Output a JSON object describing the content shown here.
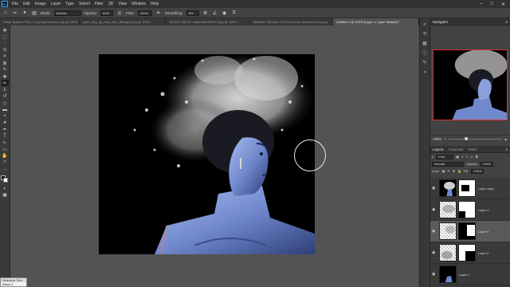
{
  "app": {
    "logo": "Ps"
  },
  "menu": [
    "File",
    "Edit",
    "Image",
    "Layer",
    "Type",
    "Select",
    "Filter",
    "3D",
    "View",
    "Window",
    "Help"
  ],
  "window_controls": [
    "–",
    "□",
    "✕"
  ],
  "options_bar": {
    "mode_label": "Mode:",
    "mode_value": "Normal",
    "opacity_label": "Opacity:",
    "opacity_value": "60%",
    "flow_label": "Flow:",
    "flow_value": "100%",
    "smoothing_label": "Smoothing:",
    "smoothing_value": "0%"
  },
  "doc_tabs": [
    {
      "label": "Water Splash PNGs 2 by pngchampion.png @ 100% ...",
      "active": false
    },
    {
      "label": "apex_png_by_mau_AVL_8Sbb(p).png @ 100% ...",
      "active": false
    },
    {
      "label": "1873d3~d06-071-6fa0-89bf3fd7c0.png @ 100% ...",
      "active": false
    },
    {
      "label": "8f2a5d0~4b0405c-4778-9ccf-83e-4b9cc2cc1fed.png",
      "active": false
    },
    {
      "label": "Untitled-1 @ 100% (Layer 1, Layer Mask/8) *",
      "active": true
    }
  ],
  "tools": [
    "move-tool",
    "marquee-tool",
    "lasso-tool",
    "quick-select-tool",
    "crop-tool",
    "frame-tool",
    "eyedropper-tool",
    "healing-tool",
    "brush-tool",
    "clone-stamp-tool",
    "history-brush-tool",
    "eraser-tool",
    "gradient-tool",
    "blur-tool",
    "dodge-tool",
    "pen-tool",
    "type-tool",
    "path-select-tool",
    "shape-tool",
    "hand-tool",
    "zoom-tool",
    "more-tools"
  ],
  "tool_glyphs": [
    "✥",
    "⬚",
    "◌",
    "⊙",
    "⌗",
    "⊠",
    "✎",
    "✚",
    "✏",
    "♙",
    "↺",
    "◇",
    "▬",
    "◓",
    "●",
    "✒",
    "T",
    "↖",
    "▭",
    "✋",
    "⌕",
    "…"
  ],
  "tooltip": {
    "title": "Selective Tool",
    "value": "Wave 2"
  },
  "navigator": {
    "title": "Navigator",
    "zoom": "100%"
  },
  "layers": {
    "tabs": [
      "Layers",
      "Channels",
      "Paths"
    ],
    "kind_label": "Kind",
    "blend_mode": "Normal",
    "opacity_label": "Opacity:",
    "opacity_value": "100%",
    "lock_label": "Lock:",
    "fill_label": "Fill:",
    "fill_value": "100%",
    "items": [
      {
        "name": "Layer copy",
        "selected": false
      },
      {
        "name": "Layer 4",
        "selected": false
      },
      {
        "name": "Layer 3",
        "selected": true
      },
      {
        "name": "Layer 2",
        "selected": false
      },
      {
        "name": "Layer 1",
        "selected": false
      }
    ]
  },
  "colors": {
    "accent_red": "#e23030",
    "skin_blue": "#7a94d6",
    "panel_bg": "#424242"
  }
}
